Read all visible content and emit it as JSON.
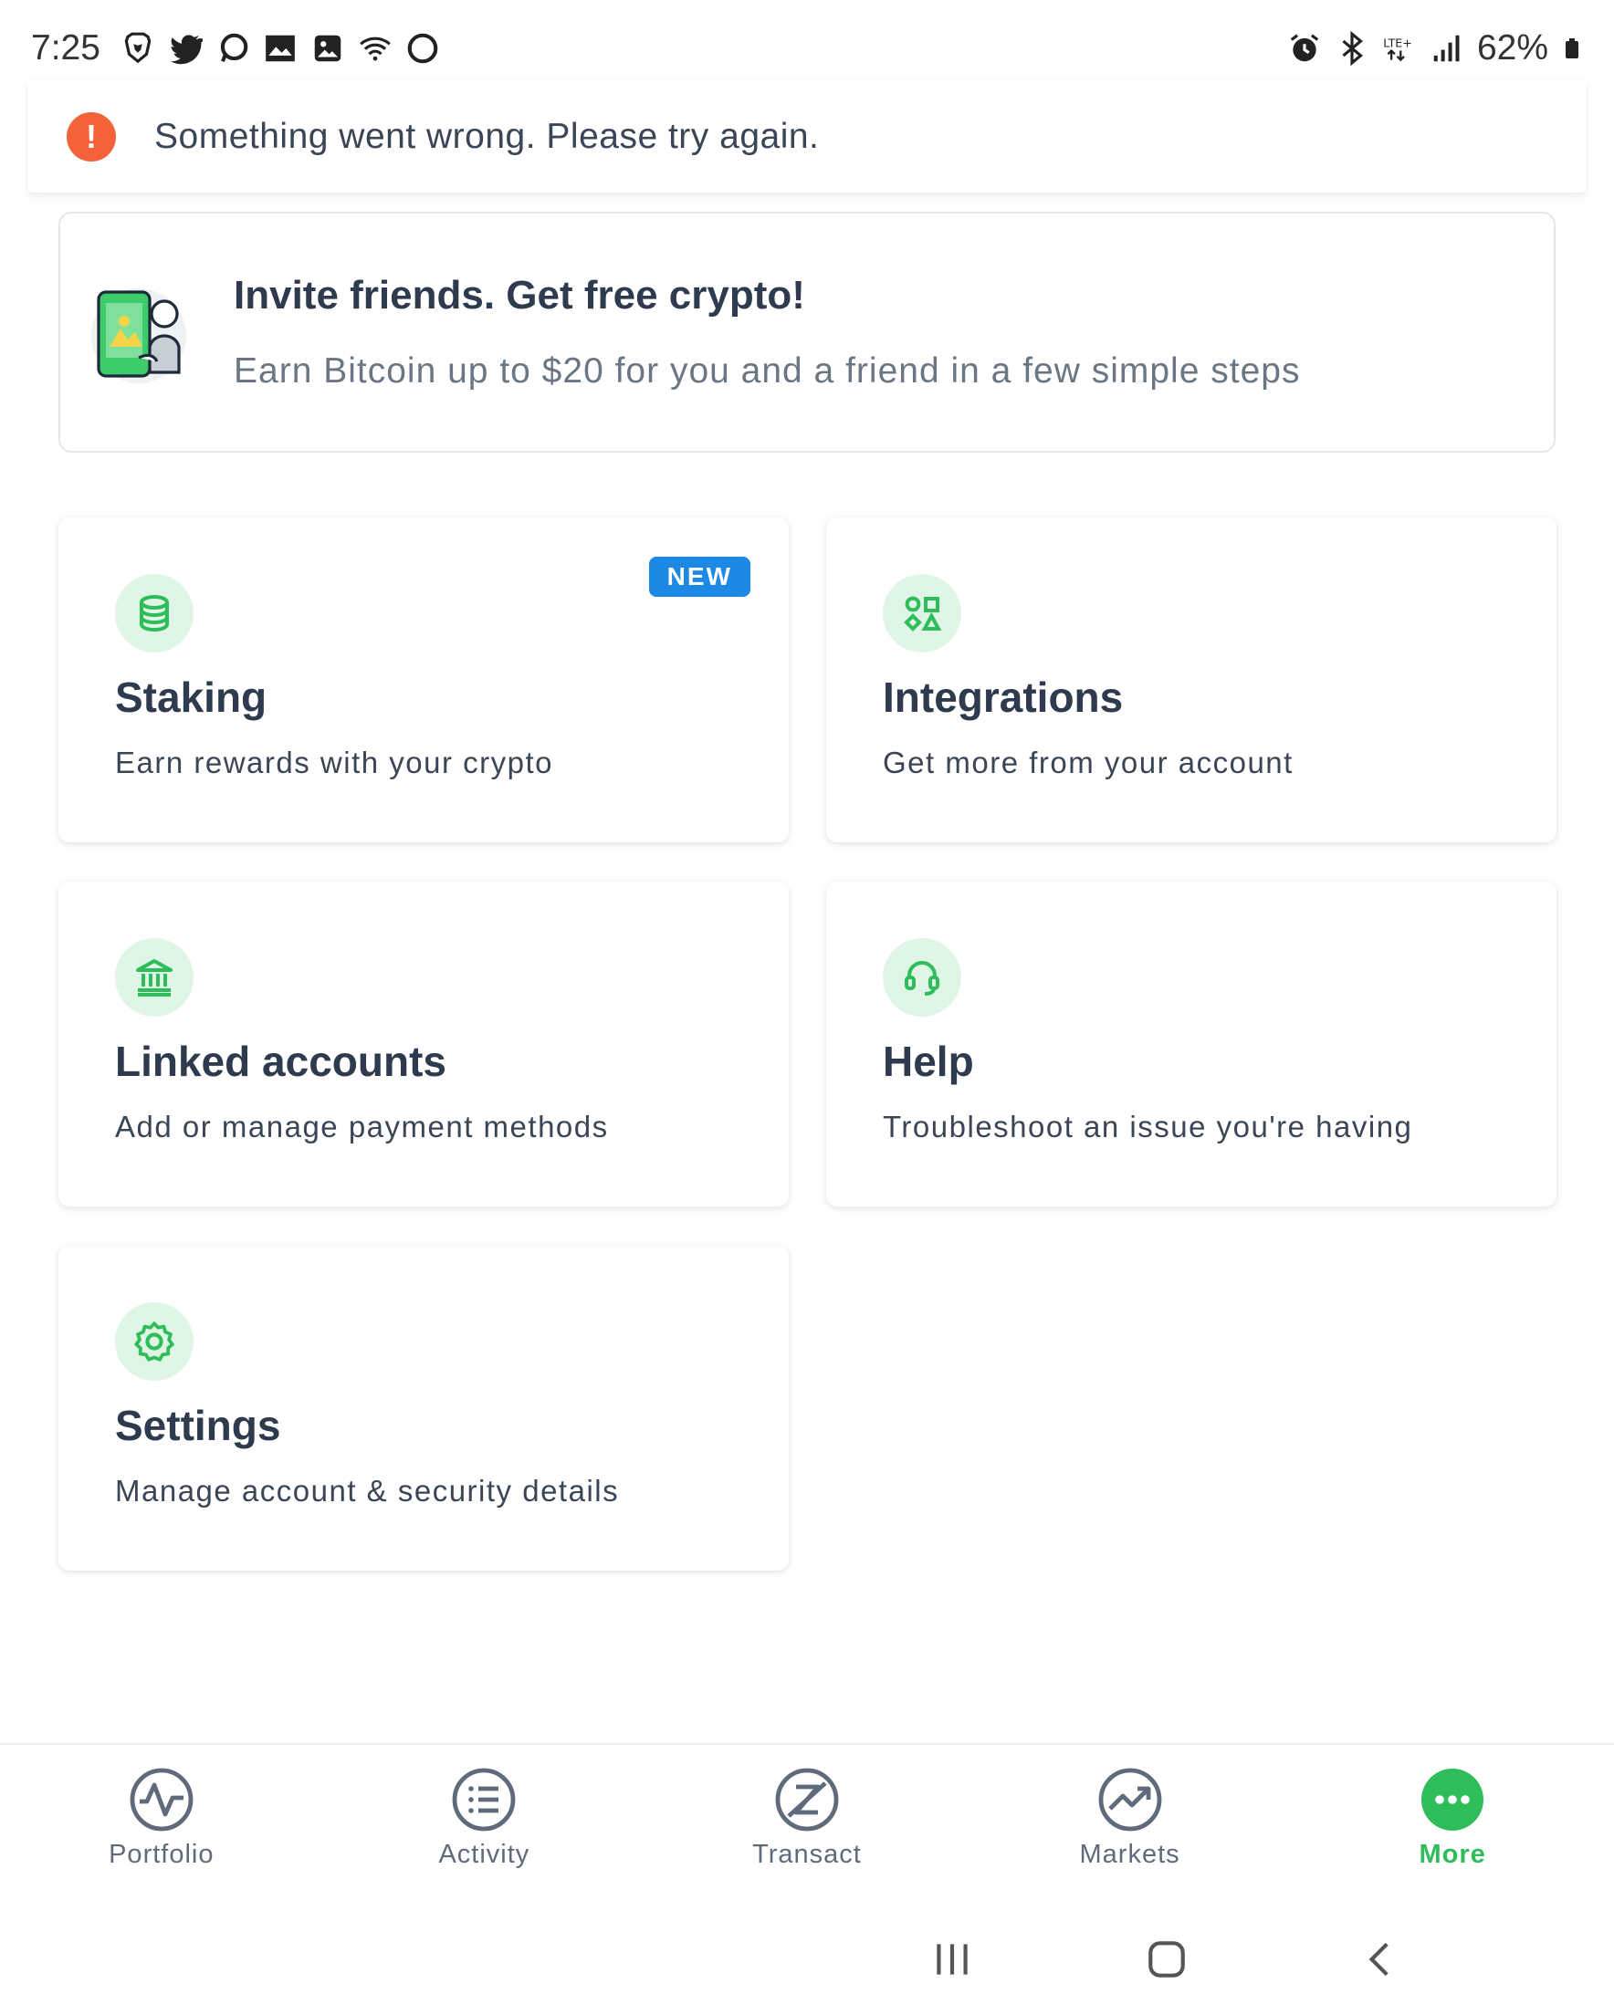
{
  "status_bar": {
    "time": "7:25",
    "battery_percent": "62%",
    "icons_left": [
      "brave-icon",
      "twitter-icon",
      "chat-icon",
      "gallery-icon",
      "image-icon",
      "wifi-icon",
      "circle-icon"
    ],
    "icons_right": [
      "alarm-icon",
      "bluetooth-icon",
      "lte-icon",
      "signal-icon",
      "battery-icon"
    ]
  },
  "toast": {
    "icon": "alert-icon",
    "message": "Something went wrong. Please try again.",
    "color": "#f4623a"
  },
  "invite": {
    "title": "Invite friends. Get free crypto!",
    "subtitle": "Earn Bitcoin up to $20 for you and a friend in a few simple steps",
    "icon": "invite-illustration"
  },
  "tiles": [
    {
      "title": "Staking",
      "subtitle": "Earn rewards with your crypto",
      "icon": "database-icon",
      "badge": "NEW"
    },
    {
      "title": "Integrations",
      "subtitle": "Get more from your account",
      "icon": "shapes-icon"
    },
    {
      "title": "Linked accounts",
      "subtitle": "Add or manage payment methods",
      "icon": "bank-icon"
    },
    {
      "title": "Help",
      "subtitle": "Troubleshoot an issue you're having",
      "icon": "headset-icon"
    },
    {
      "title": "Settings",
      "subtitle": "Manage account & security details",
      "icon": "gear-icon"
    }
  ],
  "bottom_nav": [
    {
      "label": "Portfolio",
      "icon": "portfolio-icon",
      "active": false
    },
    {
      "label": "Activity",
      "icon": "activity-icon",
      "active": false
    },
    {
      "label": "Transact",
      "icon": "transact-icon",
      "active": false
    },
    {
      "label": "Markets",
      "icon": "markets-icon",
      "active": false
    },
    {
      "label": "More",
      "icon": "more-icon",
      "active": true
    }
  ],
  "colors": {
    "accent_green": "#2ebd59",
    "icon_bg_green": "#dff5e6",
    "badge_blue": "#1e88e5",
    "text_dark": "#2e3a4d",
    "nav_gray": "#5f6b7a"
  }
}
